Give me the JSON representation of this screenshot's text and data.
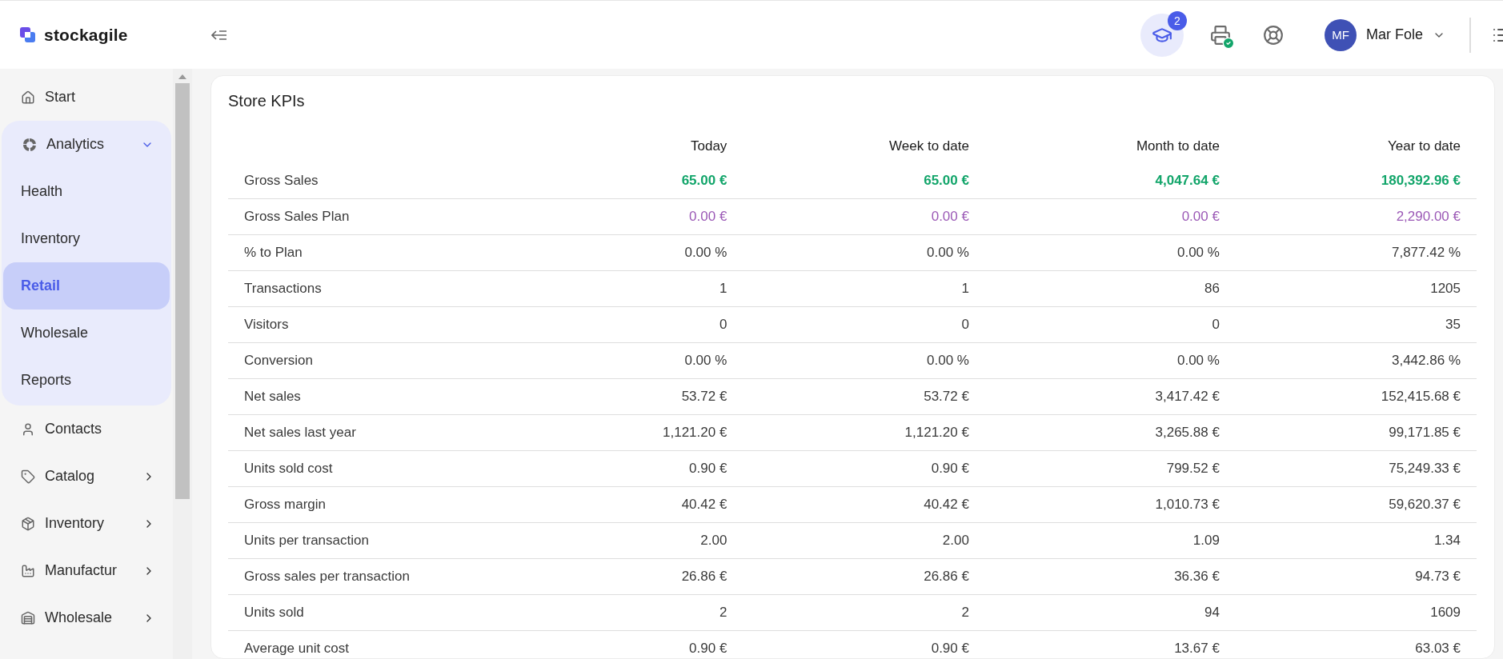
{
  "header": {
    "brand": "stockagile",
    "notifications_badge": "2",
    "user": {
      "initials": "MF",
      "name": "Mar Fole"
    }
  },
  "sidebar": {
    "items": [
      {
        "label": "Start",
        "kind": "item",
        "selected": false
      },
      {
        "label": "Analytics",
        "kind": "group",
        "expanded": true,
        "children": [
          {
            "label": "Health",
            "selected": false
          },
          {
            "label": "Inventory",
            "selected": false
          },
          {
            "label": "Retail",
            "selected": true
          },
          {
            "label": "Wholesale",
            "selected": false
          },
          {
            "label": "Reports",
            "selected": false
          }
        ]
      },
      {
        "label": "Contacts",
        "kind": "item",
        "selected": false
      },
      {
        "label": "Catalog",
        "kind": "submenu",
        "expanded": false
      },
      {
        "label": "Inventory",
        "kind": "submenu",
        "expanded": false
      },
      {
        "label": "Manufactur",
        "kind": "submenu",
        "expanded": false
      },
      {
        "label": "Wholesale",
        "kind": "submenu",
        "expanded": false
      }
    ]
  },
  "card": {
    "title": "Store KPIs",
    "table": {
      "columns": [
        "Today",
        "Week to date",
        "Month to date",
        "Year to date"
      ],
      "rows": [
        {
          "label": "Gross Sales",
          "kind": "sales",
          "values": [
            "65.00 €",
            "65.00 €",
            "4,047.64 €",
            "180,392.96 €"
          ]
        },
        {
          "label": "Gross Sales Plan",
          "kind": "plan",
          "values": [
            "0.00 €",
            "0.00 €",
            "0.00 €",
            "2,290.00 €"
          ]
        },
        {
          "label": "% to Plan",
          "kind": "plain",
          "values": [
            "0.00 %",
            "0.00 %",
            "0.00 %",
            "7,877.42 %"
          ]
        },
        {
          "label": "Transactions",
          "kind": "plain",
          "values": [
            "1",
            "1",
            "86",
            "1205"
          ]
        },
        {
          "label": "Visitors",
          "kind": "plain",
          "values": [
            "0",
            "0",
            "0",
            "35"
          ]
        },
        {
          "label": "Conversion",
          "kind": "plain",
          "values": [
            "0.00 %",
            "0.00 %",
            "0.00 %",
            "3,442.86 %"
          ]
        },
        {
          "label": "Net sales",
          "kind": "plain",
          "values": [
            "53.72 €",
            "53.72 €",
            "3,417.42 €",
            "152,415.68 €"
          ]
        },
        {
          "label": "Net sales last year",
          "kind": "plain",
          "values": [
            "1,121.20 €",
            "1,121.20 €",
            "3,265.88 €",
            "99,171.85 €"
          ]
        },
        {
          "label": "Units sold cost",
          "kind": "plain",
          "values": [
            "0.90 €",
            "0.90 €",
            "799.52 €",
            "75,249.33 €"
          ]
        },
        {
          "label": "Gross margin",
          "kind": "plain",
          "values": [
            "40.42 €",
            "40.42 €",
            "1,010.73 €",
            "59,620.37 €"
          ]
        },
        {
          "label": "Units per transaction",
          "kind": "plain",
          "values": [
            "2.00",
            "2.00",
            "1.09",
            "1.34"
          ]
        },
        {
          "label": "Gross sales per transaction",
          "kind": "plain",
          "values": [
            "26.86 €",
            "26.86 €",
            "36.36 €",
            "94.73 €"
          ]
        },
        {
          "label": "Units sold",
          "kind": "plain",
          "values": [
            "2",
            "2",
            "94",
            "1609"
          ]
        },
        {
          "label": "Average unit cost",
          "kind": "plain",
          "values": [
            "0.90 €",
            "0.90 €",
            "13.67 €",
            "63.03 €"
          ]
        }
      ]
    }
  }
}
